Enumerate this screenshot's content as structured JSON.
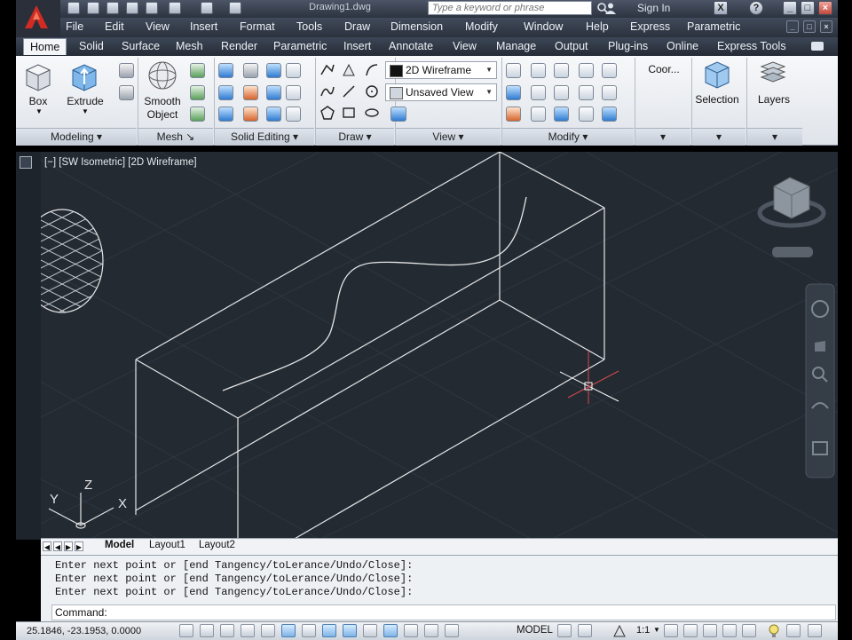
{
  "titlebar": {
    "document_title": "Drawing1.dwg",
    "search_placeholder": "Type a keyword or phrase",
    "signin_label": "Sign In",
    "window_buttons": [
      "X",
      "?",
      "_",
      "□",
      "×"
    ]
  },
  "menubar": {
    "items": [
      "File",
      "Edit",
      "View",
      "Insert",
      "Format",
      "Tools",
      "Draw",
      "Dimension",
      "Modify",
      "Window",
      "Help",
      "Express",
      "Parametric"
    ]
  },
  "ribbon": {
    "tabs": [
      "Home",
      "Solid",
      "Surface",
      "Mesh",
      "Render",
      "Parametric",
      "Insert",
      "Annotate",
      "View",
      "Manage",
      "Output",
      "Plug-ins",
      "Online",
      "Express Tools"
    ],
    "active_tab": "Home",
    "big_buttons": {
      "box": "Box",
      "extrude": "Extrude",
      "smooth_object_line1": "Smooth",
      "smooth_object_line2": "Object",
      "coordinates": "Coor...",
      "selection": "Selection",
      "layers": "Layers"
    },
    "visual_style": "2D Wireframe",
    "view_name": "Unsaved View",
    "panels": [
      "Modeling",
      "Mesh",
      "Solid Editing",
      "Draw",
      "View",
      "Modify"
    ]
  },
  "viewport": {
    "label": "[−] [SW Isometric] [2D Wireframe]",
    "ucs_x": "X",
    "ucs_y": "Y",
    "ucs_z": "Z"
  },
  "layout_tabs": [
    "Model",
    "Layout1",
    "Layout2"
  ],
  "command_line": {
    "history": [
      "Enter next point or [end Tangency/toLerance/Undo/Close]:",
      "Enter next point or [end Tangency/toLerance/Undo/Close]:",
      "Enter next point or [end Tangency/toLerance/Undo/Close]:"
    ],
    "prompt": "Command:"
  },
  "statusbar": {
    "coordinates": "25.1846, -23.1953, 0.0000",
    "model_label": "MODEL",
    "annotation_scale": "1:1"
  },
  "colors": {
    "viewport_bg": "#232a32",
    "wire": "#e6e6e6",
    "menubar": "#363e4c"
  }
}
